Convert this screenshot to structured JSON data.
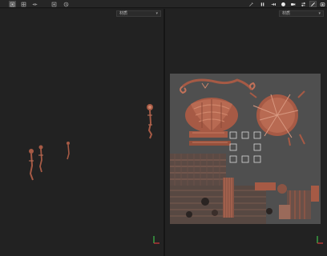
{
  "toolbar": {
    "left_tools": [
      {
        "name": "frame-view-icon",
        "active": true
      },
      {
        "name": "grid-view-icon",
        "active": false
      },
      {
        "name": "fit-icon",
        "active": false
      },
      {
        "name": "add-icon",
        "active": false
      },
      {
        "name": "history-icon",
        "active": false
      }
    ],
    "right_tools": [
      {
        "name": "wand-icon",
        "active": false
      },
      {
        "name": "pause-icon",
        "active": false
      },
      {
        "name": "step-icon",
        "active": false
      },
      {
        "name": "sphere-icon",
        "active": false
      },
      {
        "name": "camera-icon",
        "active": false
      },
      {
        "name": "swap-icon",
        "active": false
      },
      {
        "name": "brush-icon",
        "active": true
      },
      {
        "name": "screenshot-icon",
        "active": false
      }
    ]
  },
  "viewports": {
    "left": {
      "mode_select": "材质"
    },
    "right": {
      "mode_select": "材质"
    }
  },
  "colors": {
    "asset": "#a65a45",
    "asset_light": "#d0866b",
    "sheet": "#4f4f4f",
    "axis_x": "#d23a3a",
    "axis_y": "#3fbf4a"
  }
}
